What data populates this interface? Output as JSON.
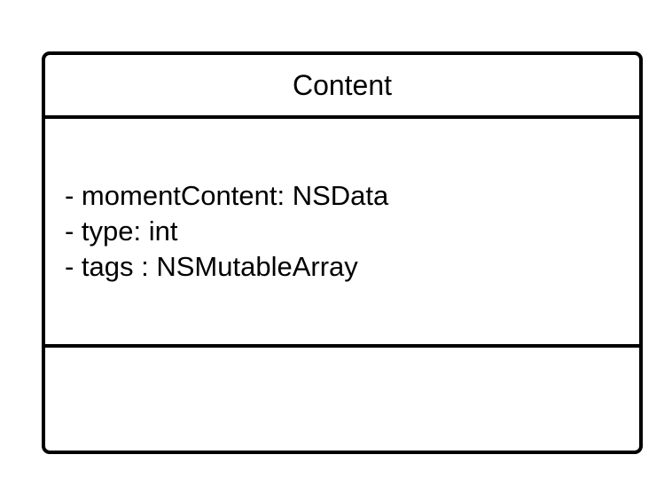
{
  "class": {
    "name": "Content",
    "attributes": [
      "- momentContent: NSData",
      "- type: int",
      "- tags : NSMutableArray"
    ],
    "methods": []
  }
}
